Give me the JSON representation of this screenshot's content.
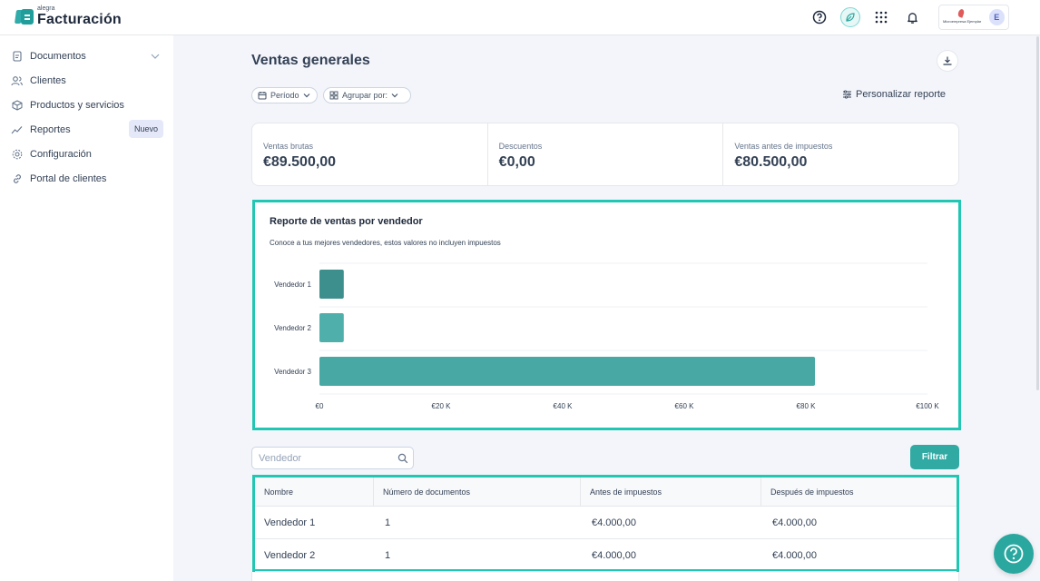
{
  "brand": {
    "small": "alegra",
    "name": "Facturación"
  },
  "topbar": {
    "icons": [
      "help-circle-icon",
      "leaf-icon",
      "apps-grid-icon",
      "bell-icon"
    ],
    "account": {
      "company_logo_text": "Microempresa Ejemplar",
      "avatar_initial": "E"
    }
  },
  "sidebar": {
    "items": [
      {
        "label": "Documentos",
        "icon": "document-icon",
        "expandable": true
      },
      {
        "label": "Clientes",
        "icon": "users-icon"
      },
      {
        "label": "Productos y servicios",
        "icon": "box-icon"
      },
      {
        "label": "Reportes",
        "icon": "trend-line-icon",
        "badge": "Nuevo"
      },
      {
        "label": "Configuración",
        "icon": "gear-icon"
      },
      {
        "label": "Portal de clientes",
        "icon": "link-icon"
      }
    ]
  },
  "main": {
    "title": "Ventas generales",
    "filters": {
      "period": "Período",
      "group_by": "Agrupar por:"
    },
    "customize": "Personalizar reporte",
    "summary": [
      {
        "label": "Ventas brutas",
        "value": "€89.500,00"
      },
      {
        "label": "Descuentos",
        "value": "€0,00"
      },
      {
        "label": "Ventas antes de impuestos",
        "value": "€80.500,00"
      }
    ]
  },
  "chart_data": {
    "type": "bar",
    "orientation": "horizontal",
    "title": "Reporte de ventas por vendedor",
    "subtitle": "Conoce a tus mejores vendedores, estos valores no incluyen impuestos",
    "categories": [
      "Vendedor 1",
      "Vendedor 2",
      "Vendedor 3"
    ],
    "values": [
      4000,
      4000,
      81500
    ],
    "colors": [
      "#3c8f8c",
      "#4fb0ab",
      "#47a8a4"
    ],
    "xlim": [
      0,
      100000
    ],
    "xticks": [
      0,
      20000,
      40000,
      60000,
      80000,
      100000
    ],
    "xtick_labels": [
      "€0",
      "€20 K",
      "€40 K",
      "€60 K",
      "€80 K",
      "€100 K"
    ],
    "grid": true,
    "legend": "none"
  },
  "table": {
    "search_placeholder": "Vendedor",
    "filter_label": "Filtrar",
    "columns": [
      "Nombre",
      "Número de documentos",
      "Antes de impuestos",
      "Después de impuestos"
    ],
    "rows": [
      [
        "Vendedor 1",
        "1",
        "€4.000,00",
        "€4.000,00"
      ],
      [
        "Vendedor 2",
        "1",
        "€4.000,00",
        "€4.000,00"
      ]
    ]
  }
}
